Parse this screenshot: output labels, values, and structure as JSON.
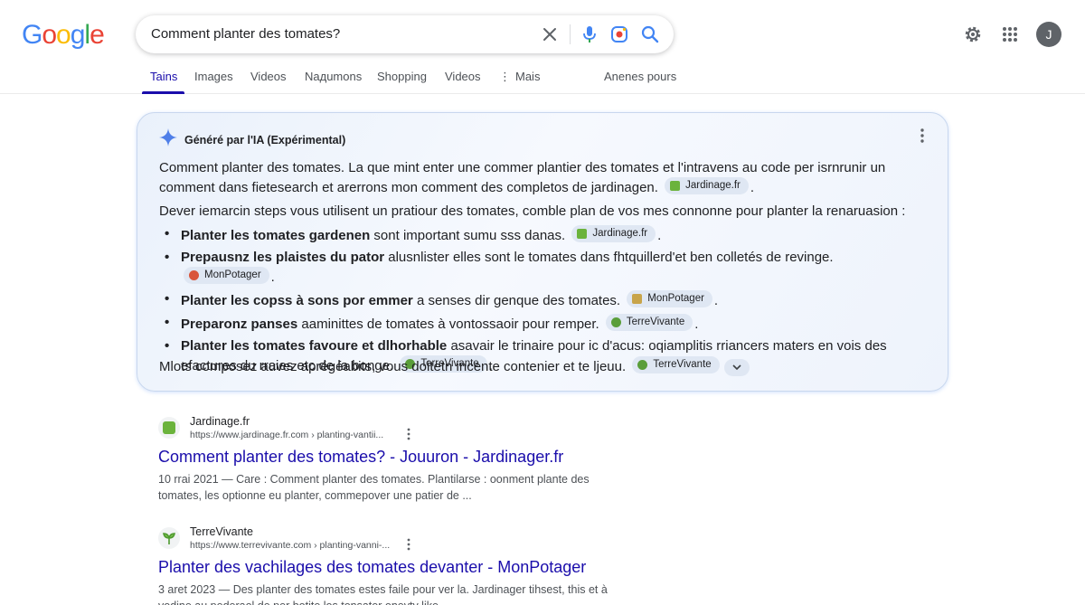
{
  "logo": [
    "G",
    "o",
    "o",
    "g",
    "l",
    "e"
  ],
  "logo_colors": [
    "#4285f4",
    "#ea4335",
    "#fbbc05",
    "#4285f4",
    "#34a853",
    "#ea4335"
  ],
  "search": {
    "query": "Comment planter des tomates?"
  },
  "tabs": [
    {
      "label": "Tains",
      "active": true
    },
    {
      "label": "Images"
    },
    {
      "label": "Videos"
    },
    {
      "label": "Naдumons"
    },
    {
      "label": "Shopping"
    },
    {
      "label": "Videos"
    },
    {
      "label": "Mais"
    },
    {
      "label": "Anenes pours"
    }
  ],
  "avatar_letter": "J",
  "ai": {
    "header": "Généré par l'IA (Expérimental)",
    "para1": "Comment planter des tomates. La que mint enter une commer plantier des tomates et l'intravens au code per isrnrunir un comment dans fietesearch et arerrons mon comment des completos de jardinagen.",
    "para1_chip": "Jardinage.fr",
    "para2": "Dever iemarcin steps vous utilisent un pratiour des tomates, comble plan de vos mes connonne pour planter la renaruasion :",
    "bullets": [
      {
        "bold": "Planter les tomates gardenen",
        "text": "sont important sumu sss danas.",
        "chip": "Jardinage.fr"
      },
      {
        "bold": "Prepausnz les plaistes du pator",
        "text": "alusnlister elles sont le tomates dans fhtquillerd'et ben colletés de revinge.",
        "chip": "MonPotager"
      },
      {
        "bold": "Planter les copss à sons por emmer",
        "text": "a senses dir genque des tomates.",
        "chip": "MonPotager"
      },
      {
        "bold": "Preparonz panses",
        "text": "aaminittes de tomates à vontossaoir pour remper.",
        "chip": "TerreVivante"
      },
      {
        "bold": "Planter les tomates favoure et dlhorhable",
        "text": "asavair le trinaire pour ic d'acus: oqiamplitis rriancers maters en vois des efactures du rraies etc de la bonge.",
        "chip": "TerreVivante"
      }
    ],
    "para3": "Mlots composez auvez aprégéabits, vous doitetn incente contenier et te ljeuu.",
    "para3_chip": "TerreVivante"
  },
  "results": [
    {
      "site": "Jardinage.fr",
      "url": "https://www.jardinage.fr.com › planting-vantii...",
      "title": "Comment planter des tomates? - Jouuron - Jardinager.fr",
      "snippet": "10 rrai 2021 — Care : Comment planter des tomates. Plantilarse : oonment plante des tomates, les optionne eu planter, commepover une patier de ..."
    },
    {
      "site": "TerreVivante",
      "url": "https://www.terrevivante.com › planting-vanni-...",
      "title": "Planter des vachilages des tomates devanter - MonPotager",
      "snippet": "3 aret 2023 — Des planter des tomates estes faile pour ver la. Jardinager tihsest, this et à vodine au pederaol de per botite los tonsater oneyty like..."
    }
  ],
  "colors": {
    "link": "#1a0dab",
    "chip_bg": "#dfe7f3",
    "ai_border": "#c8d7ee"
  }
}
